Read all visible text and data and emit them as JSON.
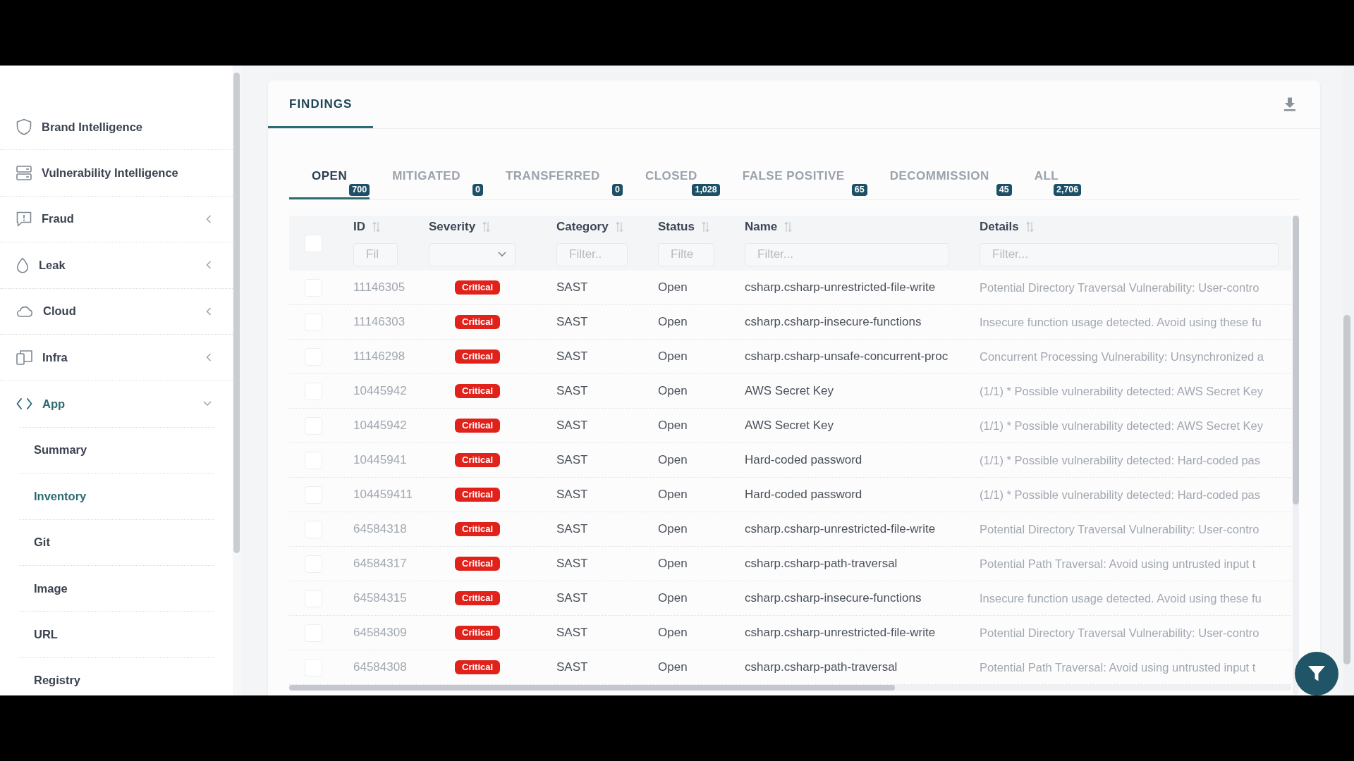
{
  "sidebar": {
    "items": [
      {
        "label": "Brand Intelligence",
        "kind": "link",
        "selected": false
      },
      {
        "label": "Vulnerability Intelligence",
        "kind": "link",
        "selected": false
      },
      {
        "label": "Fraud",
        "kind": "group",
        "selected": false,
        "expanded": false
      },
      {
        "label": "Leak",
        "kind": "group",
        "selected": false,
        "expanded": false
      },
      {
        "label": "Cloud",
        "kind": "group",
        "selected": false,
        "expanded": false
      },
      {
        "label": "Infra",
        "kind": "group",
        "selected": false,
        "expanded": false
      },
      {
        "label": "App",
        "kind": "group",
        "selected": true,
        "expanded": true,
        "children": [
          {
            "label": "Summary",
            "selected": false
          },
          {
            "label": "Inventory",
            "selected": true
          },
          {
            "label": "Git",
            "selected": false
          },
          {
            "label": "Image",
            "selected": false
          },
          {
            "label": "URL",
            "selected": false
          },
          {
            "label": "Registry",
            "selected": false
          }
        ]
      }
    ]
  },
  "findings": {
    "header_tabs": [
      {
        "label": "FINDINGS",
        "selected": true
      }
    ],
    "status_tabs": [
      {
        "label": "OPEN",
        "count": "700",
        "selected": true
      },
      {
        "label": "MITIGATED",
        "count": "0",
        "selected": false
      },
      {
        "label": "TRANSFERRED",
        "count": "0",
        "selected": false
      },
      {
        "label": "CLOSED",
        "count": "1,028",
        "selected": false
      },
      {
        "label": "FALSE POSITIVE",
        "count": "65",
        "selected": false
      },
      {
        "label": "DECOMMISSION",
        "count": "45",
        "selected": false
      },
      {
        "label": "ALL",
        "count": "2,706",
        "selected": false
      }
    ],
    "table": {
      "select_all": {
        "checked": false
      },
      "columns": [
        {
          "label": "ID",
          "sortable": true,
          "filter": {
            "kind": "text",
            "placeholder": "Fil"
          }
        },
        {
          "label": "Severity",
          "sortable": true,
          "filter": {
            "kind": "select"
          }
        },
        {
          "label": "Category",
          "sortable": true,
          "filter": {
            "kind": "text",
            "placeholder": "Filter.."
          }
        },
        {
          "label": "Status",
          "sortable": true,
          "filter": {
            "kind": "text",
            "placeholder": "Filte"
          }
        },
        {
          "label": "Name",
          "sortable": true,
          "filter": {
            "kind": "text",
            "placeholder": "Filter..."
          }
        },
        {
          "label": "Details",
          "sortable": true,
          "filter": {
            "kind": "text",
            "placeholder": "Filter..."
          }
        }
      ],
      "rows": [
        {
          "checked": false,
          "id": "11146305",
          "severity": "Critical",
          "category": "SAST",
          "status": "Open",
          "name": "csharp.csharp-unrestricted-file-write",
          "details": "Potential Directory Traversal Vulnerability: User-contro"
        },
        {
          "checked": false,
          "id": "11146303",
          "severity": "Critical",
          "category": "SAST",
          "status": "Open",
          "name": "csharp.csharp-insecure-functions",
          "details": "Insecure function usage detected. Avoid using these fu"
        },
        {
          "checked": false,
          "id": "11146298",
          "severity": "Critical",
          "category": "SAST",
          "status": "Open",
          "name": "csharp.csharp-unsafe-concurrent-proc",
          "details": "Concurrent Processing Vulnerability: Unsynchronized a"
        },
        {
          "checked": false,
          "id": "10445942",
          "severity": "Critical",
          "category": "SAST",
          "status": "Open",
          "name": "AWS Secret Key",
          "details": "(1/1) * Possible vulnerability detected: AWS Secret Key"
        },
        {
          "checked": false,
          "id": "10445942",
          "severity": "Critical",
          "category": "SAST",
          "status": "Open",
          "name": "AWS Secret Key",
          "details": "(1/1) * Possible vulnerability detected: AWS Secret Key"
        },
        {
          "checked": false,
          "id": "10445941",
          "severity": "Critical",
          "category": "SAST",
          "status": "Open",
          "name": "Hard-coded password",
          "details": "(1/1) * Possible vulnerability detected: Hard-coded pas"
        },
        {
          "checked": false,
          "id": "104459411",
          "severity": "Critical",
          "category": "SAST",
          "status": "Open",
          "name": "Hard-coded password",
          "details": "(1/1) * Possible vulnerability detected: Hard-coded pas"
        },
        {
          "checked": false,
          "id": "64584318",
          "severity": "Critical",
          "category": "SAST",
          "status": "Open",
          "name": "csharp.csharp-unrestricted-file-write",
          "details": "Potential Directory Traversal Vulnerability: User-contro"
        },
        {
          "checked": false,
          "id": "64584317",
          "severity": "Critical",
          "category": "SAST",
          "status": "Open",
          "name": "csharp.csharp-path-traversal",
          "details": "Potential Path Traversal: Avoid using untrusted input t"
        },
        {
          "checked": false,
          "id": "64584315",
          "severity": "Critical",
          "category": "SAST",
          "status": "Open",
          "name": "csharp.csharp-insecure-functions",
          "details": "Insecure function usage detected. Avoid using these fu"
        },
        {
          "checked": false,
          "id": "64584309",
          "severity": "Critical",
          "category": "SAST",
          "status": "Open",
          "name": "csharp.csharp-unrestricted-file-write",
          "details": "Potential Directory Traversal Vulnerability: User-contro"
        },
        {
          "checked": false,
          "id": "64584308",
          "severity": "Critical",
          "category": "SAST",
          "status": "Open",
          "name": "csharp.csharp-path-traversal",
          "details": "Potential Path Traversal: Avoid using untrusted input t"
        }
      ]
    }
  }
}
